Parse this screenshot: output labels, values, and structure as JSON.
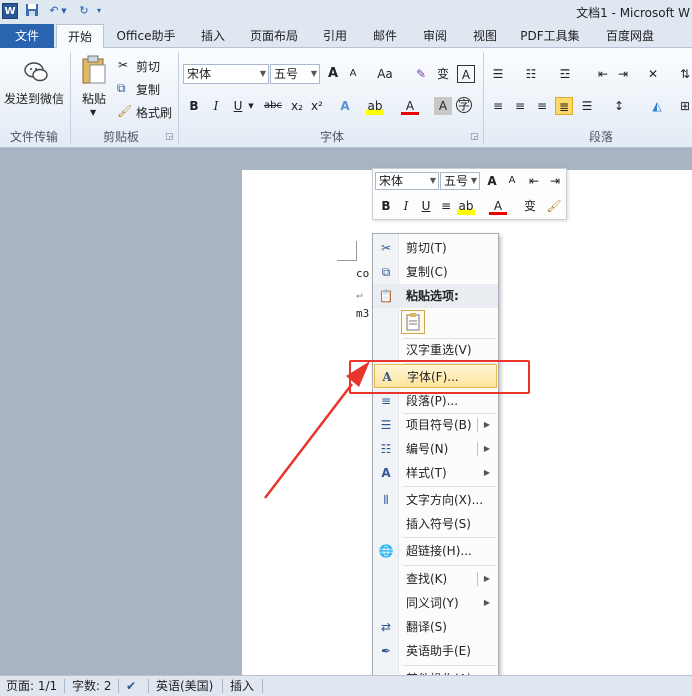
{
  "titlebar": {
    "title": "文档1 - Microsoft W",
    "word_icon": "W"
  },
  "tabs": [
    "文件",
    "开始",
    "Office助手",
    "插入",
    "页面布局",
    "引用",
    "邮件",
    "审阅",
    "视图",
    "PDF工具集",
    "百度网盘"
  ],
  "ribbon": {
    "wechat": {
      "label": "发送到微信",
      "group": "文件传输"
    },
    "clipboard": {
      "paste": "粘贴",
      "cut": "剪切",
      "copy": "复制",
      "format_painter": "格式刷",
      "group": "剪贴板"
    },
    "font": {
      "name": "宋体",
      "size": "五号",
      "grow": "A",
      "shrink": "A",
      "case": "Aa",
      "group": "字体"
    },
    "paragraph": {
      "group": "段落"
    }
  },
  "document": {
    "lines": [
      "co",
      "↵",
      "m3"
    ]
  },
  "minibar": {
    "font_name": "宋体",
    "font_size": "五号"
  },
  "context_menu": {
    "items": [
      {
        "label": "剪切(T)",
        "icon": "scissors-icon"
      },
      {
        "label": "复制(C)",
        "icon": "copy-icon"
      },
      {
        "label": "粘贴选项:",
        "icon": "paste-icon"
      },
      {
        "label": "汉字重选(V)"
      },
      {
        "label": "字体(F)...",
        "icon": "font-icon"
      },
      {
        "label": "段落(P)...",
        "icon": "paragraph-icon"
      },
      {
        "label": "项目符号(B)",
        "icon": "bullets-icon"
      },
      {
        "label": "编号(N)",
        "icon": "numbering-icon"
      },
      {
        "label": "样式(T)",
        "icon": "styles-icon"
      },
      {
        "label": "文字方向(X)...",
        "icon": "text-direction-icon"
      },
      {
        "label": "插入符号(S)"
      },
      {
        "label": "超链接(H)...",
        "icon": "hyperlink-icon"
      },
      {
        "label": "查找(K)"
      },
      {
        "label": "同义词(Y)"
      },
      {
        "label": "翻译(S)",
        "icon": "translate-icon"
      },
      {
        "label": "英语助手(E)",
        "icon": "english-assistant-icon"
      },
      {
        "label": "其他操作(A)"
      }
    ]
  },
  "statusbar": {
    "page": "页面: 1/1",
    "words": "字数: 2",
    "language": "英语(美国)",
    "mode": "插入"
  },
  "colors": {
    "accent": "#2a64b0",
    "highlight": "#e8352b",
    "hover": "#ffe49b"
  }
}
